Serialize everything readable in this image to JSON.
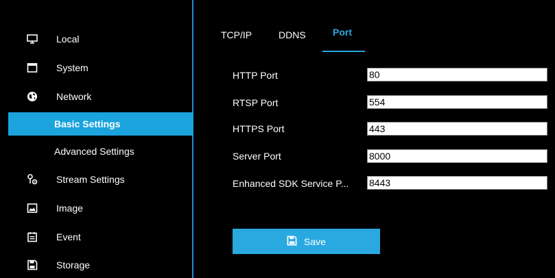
{
  "sidebar": {
    "items": [
      {
        "label": "Local",
        "icon": "monitor-icon"
      },
      {
        "label": "System",
        "icon": "system-icon"
      },
      {
        "label": "Network",
        "icon": "globe-icon"
      },
      {
        "label": "Basic Settings"
      },
      {
        "label": "Advanced Settings"
      },
      {
        "label": "Stream Settings",
        "icon": "stream-icon"
      },
      {
        "label": "Image",
        "icon": "image-icon"
      },
      {
        "label": "Event",
        "icon": "event-icon"
      },
      {
        "label": "Storage",
        "icon": "storage-icon"
      }
    ],
    "active_item": "Basic Settings"
  },
  "tabs": [
    {
      "label": "TCP/IP"
    },
    {
      "label": "DDNS"
    },
    {
      "label": "Port"
    }
  ],
  "active_tab": "Port",
  "form": {
    "rows": [
      {
        "label": "HTTP Port",
        "value": "80"
      },
      {
        "label": "RTSP Port",
        "value": "554"
      },
      {
        "label": "HTTPS Port",
        "value": "443"
      },
      {
        "label": "Server Port",
        "value": "8000"
      },
      {
        "label": "Enhanced SDK Service P...",
        "value": "8443"
      }
    ]
  },
  "save_button": {
    "label": "Save",
    "icon": "floppy-disk-icon"
  },
  "colors": {
    "background": "#000000",
    "accent": "#1aa3dd",
    "divider": "#1e90d6",
    "button": "#29a9e0",
    "text": "#ffffff"
  }
}
